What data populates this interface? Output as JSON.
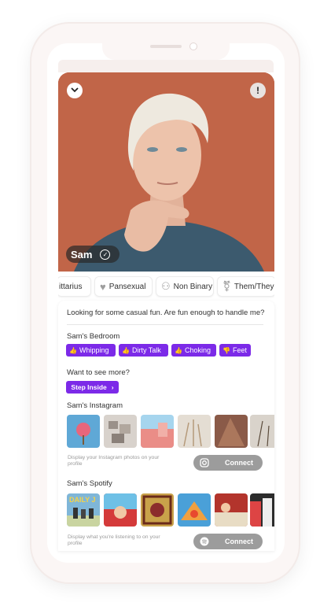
{
  "profile": {
    "name": "Sam",
    "tagline": "Looking for some casual fun. Are fun enough to handle me?"
  },
  "chips": [
    {
      "label": "ittarius",
      "icon": "sagittarius-icon"
    },
    {
      "label": "Pansexual",
      "icon": "heart-icon"
    },
    {
      "label": "Non Binary",
      "icon": "people-icon"
    },
    {
      "label": "Them/They",
      "icon": "gender-icon"
    }
  ],
  "bedroom": {
    "title": "Sam's Bedroom",
    "tags": [
      {
        "label": "Whipping",
        "icon": "thumbs-up-icon"
      },
      {
        "label": "Dirty Talk",
        "icon": "thumbs-up-icon"
      },
      {
        "label": "Choking",
        "icon": "thumbs-up-icon"
      },
      {
        "label": "Feet",
        "icon": "thumbs-down-icon"
      }
    ]
  },
  "more": {
    "title": "Want to see more?",
    "button": "Step Inside"
  },
  "instagram": {
    "title": "Sam's Instagram",
    "caption": "Display your Instagram photos on your profile",
    "connect": "Connect",
    "thumbs": [
      "#5fa8d6",
      "#d8d2cc",
      "#e98f89",
      "#e4ddd3",
      "#8a5a48",
      "#d9d3cb"
    ]
  },
  "spotify": {
    "title": "Sam's Spotify",
    "caption": "Display what you're listening to on your profile",
    "connect": "Connect",
    "thumbs": [
      "#7fb6d8",
      "#d43a3a",
      "#c9a24a",
      "#4aa0d8",
      "#b3342c",
      "#2c2c2c"
    ],
    "first_album_text": "DAILY J"
  },
  "colors": {
    "accent": "#7c2ae8",
    "connect_bg": "#9c9c9c",
    "photo_bg": "#c0674a"
  }
}
